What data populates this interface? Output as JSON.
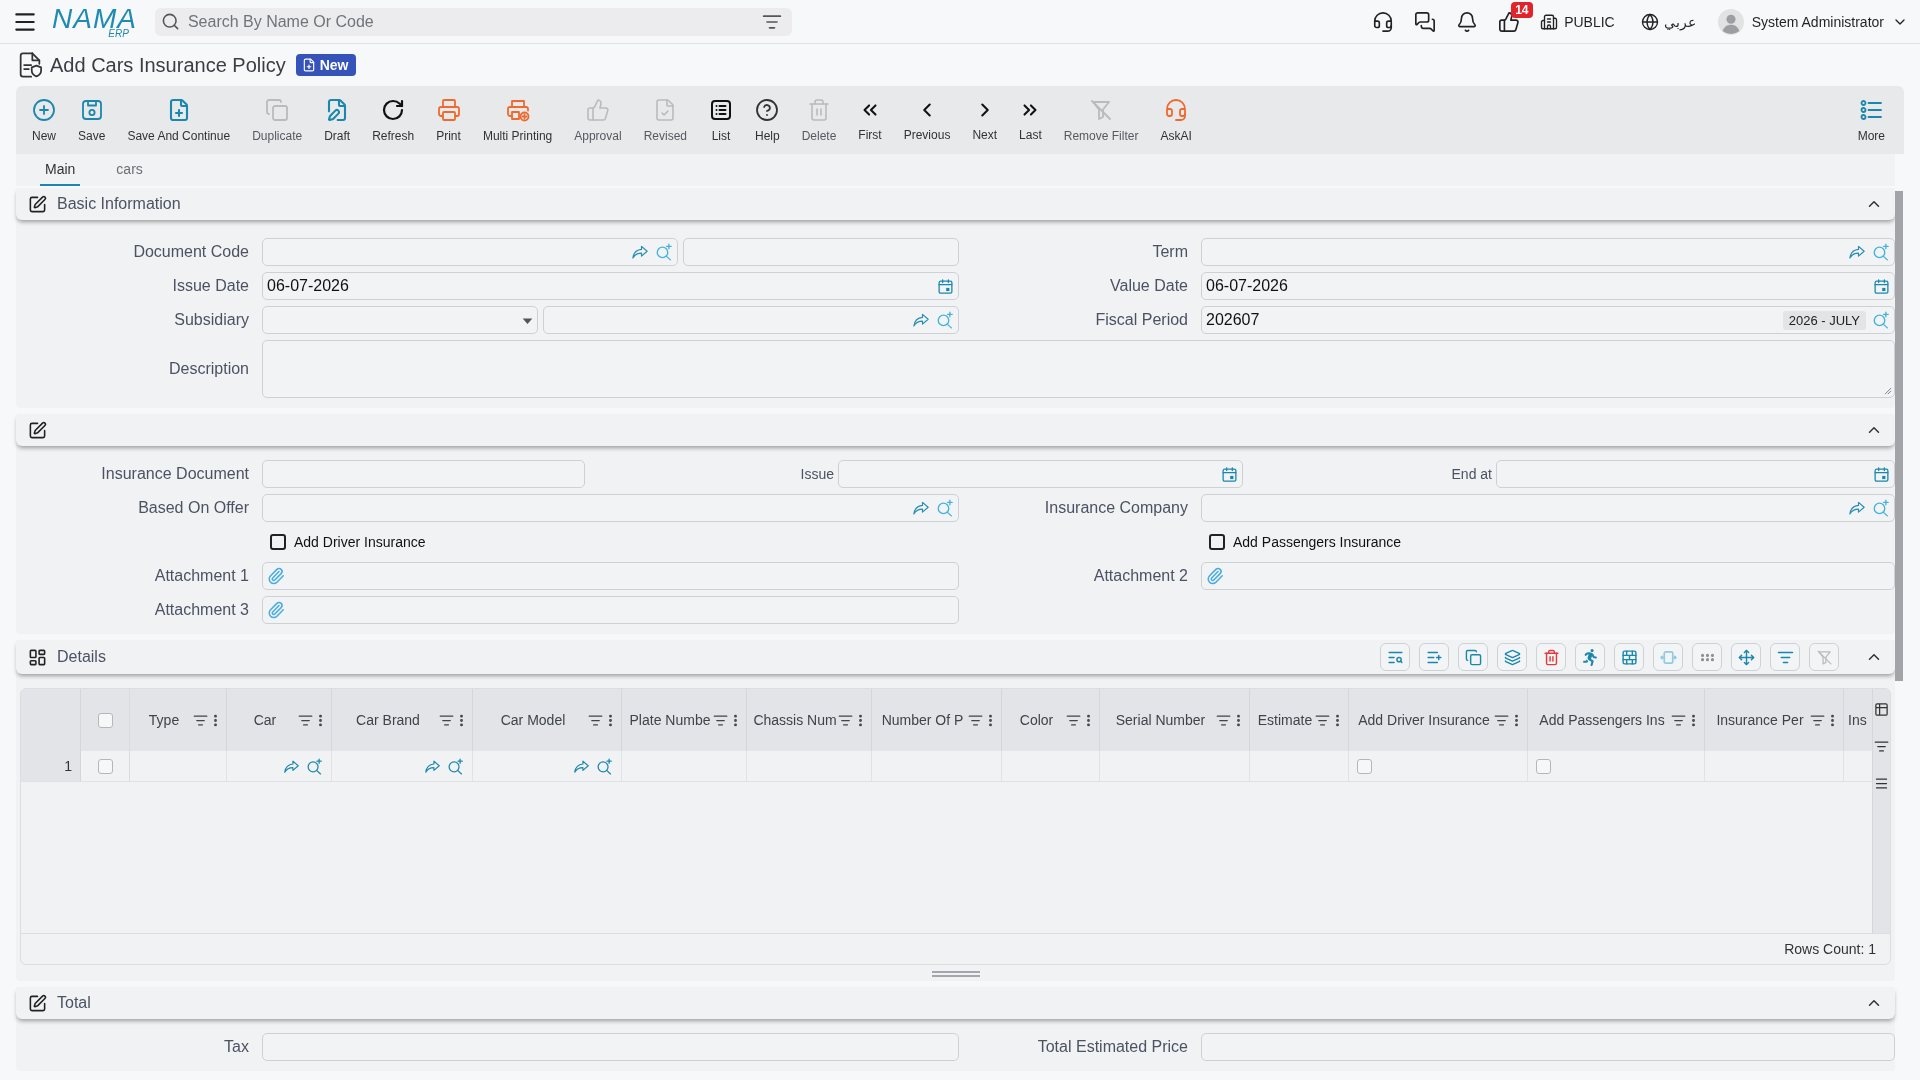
{
  "topbar": {
    "logo": {
      "wordmark": "NAMA",
      "subtitle": "ERP"
    },
    "search": {
      "placeholder": "Search By Name Or Code"
    },
    "notifications": {
      "count": "14"
    },
    "workspace": "PUBLIC",
    "language": "عربي",
    "user": "System Administrator"
  },
  "page": {
    "title": "Add Cars Insurance Policy",
    "status": "New"
  },
  "toolbar": {
    "actions": [
      {
        "label": "New",
        "color": "#1b87ad",
        "disabled": false
      },
      {
        "label": "Save",
        "color": "#1b87ad",
        "disabled": false
      },
      {
        "label": "Save And Continue",
        "color": "#1b87ad",
        "disabled": false
      },
      {
        "label": "Duplicate",
        "color": "#b8bbbf",
        "disabled": true
      },
      {
        "label": "Draft",
        "color": "#1b87ad",
        "disabled": false
      },
      {
        "label": "Refresh",
        "color": "#111111",
        "disabled": false
      },
      {
        "label": "Print",
        "color": "#ef6a2e",
        "disabled": false
      },
      {
        "label": "Multi Printing",
        "color": "#ef6a2e",
        "disabled": false
      },
      {
        "label": "Approval",
        "color": "#b8bbbf",
        "disabled": true
      },
      {
        "label": "Revised",
        "color": "#b8bbbf",
        "disabled": true
      },
      {
        "label": "List",
        "color": "#111111",
        "disabled": false
      },
      {
        "label": "Help",
        "color": "#333333",
        "disabled": false
      },
      {
        "label": "Delete",
        "color": "#b8bbbf",
        "disabled": true
      },
      {
        "label": "First",
        "color": "#111111",
        "disabled": false
      },
      {
        "label": "Previous",
        "color": "#111111",
        "disabled": false
      },
      {
        "label": "Next",
        "color": "#111111",
        "disabled": false
      },
      {
        "label": "Last",
        "color": "#111111",
        "disabled": false
      },
      {
        "label": "Remove Filter",
        "color": "#b8bbbf",
        "disabled": true
      },
      {
        "label": "AskAI",
        "color": "#ef6a2e",
        "disabled": false
      }
    ],
    "more": {
      "label": "More",
      "color": "#1b87ad"
    }
  },
  "tabs": [
    {
      "label": "Main",
      "selected": true
    },
    {
      "label": "cars",
      "selected": false
    }
  ],
  "sections": [
    {
      "kind": "form",
      "title": "Basic Information",
      "expanded": true,
      "rows": [
        {
          "kind": "pair",
          "fields": [
            {
              "label": "Document Code",
              "inputs": [
                {
                  "kind": "lookup"
                },
                {
                  "kind": "text"
                }
              ]
            },
            {
              "label": "Term",
              "inputs": [
                {
                  "kind": "lookup"
                }
              ]
            }
          ]
        },
        {
          "kind": "pair",
          "fields": [
            {
              "label": "Issue Date",
              "inputs": [
                {
                  "kind": "date",
                  "value": "06-07-2026"
                }
              ]
            },
            {
              "label": "Value Date",
              "inputs": [
                {
                  "kind": "date",
                  "value": "06-07-2026"
                }
              ]
            }
          ]
        },
        {
          "kind": "pair",
          "fields": [
            {
              "label": "Subsidiary",
              "inputs": [
                {
                  "kind": "select"
                },
                {
                  "kind": "lookup"
                }
              ]
            },
            {
              "label": "Fiscal Period",
              "inputs": [
                {
                  "kind": "period",
                  "value": "202607",
                  "caption": "2026 - JULY"
                }
              ]
            }
          ]
        },
        {
          "kind": "wide",
          "fields": [
            {
              "label": "Description",
              "inputs": [
                {
                  "kind": "textarea"
                }
              ]
            }
          ]
        }
      ]
    },
    {
      "kind": "form",
      "expanded": true,
      "rows": [
        {
          "kind": "triple",
          "fields": [
            {
              "label": "Insurance Document",
              "inputs": [
                {
                  "kind": "text"
                }
              ]
            },
            {
              "label": "Issue",
              "inputs": [
                {
                  "kind": "date"
                }
              ]
            },
            {
              "label": "End at",
              "inputs": [
                {
                  "kind": "date"
                }
              ]
            }
          ]
        },
        {
          "kind": "pair",
          "fields": [
            {
              "label": "Based On Offer",
              "inputs": [
                {
                  "kind": "lookup"
                }
              ]
            },
            {
              "label": "Insurance Company",
              "inputs": [
                {
                  "kind": "lookup"
                }
              ]
            }
          ]
        },
        {
          "kind": "checks",
          "fields": [
            {
              "label": "Add Driver Insurance",
              "checked": false
            },
            {
              "label": "Add Passengers Insurance",
              "checked": false
            }
          ]
        },
        {
          "kind": "pair",
          "fields": [
            {
              "label": "Attachment 1",
              "inputs": [
                {
                  "kind": "attachment"
                }
              ]
            },
            {
              "label": "Attachment 2",
              "inputs": [
                {
                  "kind": "attachment"
                }
              ]
            }
          ]
        },
        {
          "kind": "pair",
          "fields": [
            {
              "label": "Attachment 3",
              "inputs": [
                {
                  "kind": "attachment"
                }
              ]
            }
          ]
        }
      ]
    },
    {
      "kind": "grid",
      "title": "Details",
      "expanded": true,
      "tools": [
        {
          "color": "#1b87ad"
        },
        {
          "color": "#1b87ad"
        },
        {
          "color": "#1b87ad"
        },
        {
          "color": "#1b87ad"
        },
        {
          "color": "#e5383b"
        },
        {
          "color": "#1b87ad"
        },
        {
          "color": "#1b87ad"
        },
        {
          "color": "#8fcbe3"
        },
        {
          "color": "#8a8f96"
        },
        {
          "color": "#1b87ad"
        },
        {
          "color": "#1b87ad"
        },
        {
          "color": "#b8bbbf"
        }
      ],
      "select_all": {
        "checked": false
      },
      "columns": [
        {
          "label": "Type",
          "filter": true
        },
        {
          "label": "Car",
          "filter": true
        },
        {
          "label": "Car Brand",
          "filter": true
        },
        {
          "label": "Car Model",
          "filter": true
        },
        {
          "label": "Plate Numbe",
          "filter": true
        },
        {
          "label": "Chassis Num",
          "filter": true
        },
        {
          "label": "Number Of P",
          "filter": true
        },
        {
          "label": "Color",
          "filter": true
        },
        {
          "label": "Serial Number",
          "filter": true
        },
        {
          "label": "Estimate",
          "filter": true
        },
        {
          "label": "Add Driver Insurance",
          "filter": true
        },
        {
          "label": "Add Passengers Ins",
          "filter": true
        },
        {
          "label": "Insurance Per",
          "filter": true
        },
        {
          "label": "Ins",
          "filter": false
        }
      ],
      "rows": [
        {
          "number": "1",
          "checked": false,
          "cells": [
            {
              "kind": "text"
            },
            {
              "kind": "lookup"
            },
            {
              "kind": "lookup"
            },
            {
              "kind": "lookup"
            },
            {
              "kind": "text"
            },
            {
              "kind": "text"
            },
            {
              "kind": "text"
            },
            {
              "kind": "text"
            },
            {
              "kind": "text"
            },
            {
              "kind": "text"
            },
            {
              "kind": "checkbox",
              "checked": false
            },
            {
              "kind": "checkbox",
              "checked": false
            },
            {
              "kind": "text"
            },
            {
              "kind": "text"
            }
          ]
        }
      ],
      "footer": "Rows Count: 1"
    },
    {
      "kind": "form",
      "title": "Total",
      "expanded": true,
      "rows": [
        {
          "kind": "pair",
          "fields": [
            {
              "label": "Tax",
              "inputs": [
                {
                  "kind": "text"
                }
              ]
            },
            {
              "label": "Total Estimated Price",
              "inputs": [
                {
                  "kind": "text"
                }
              ]
            }
          ]
        }
      ]
    }
  ]
}
